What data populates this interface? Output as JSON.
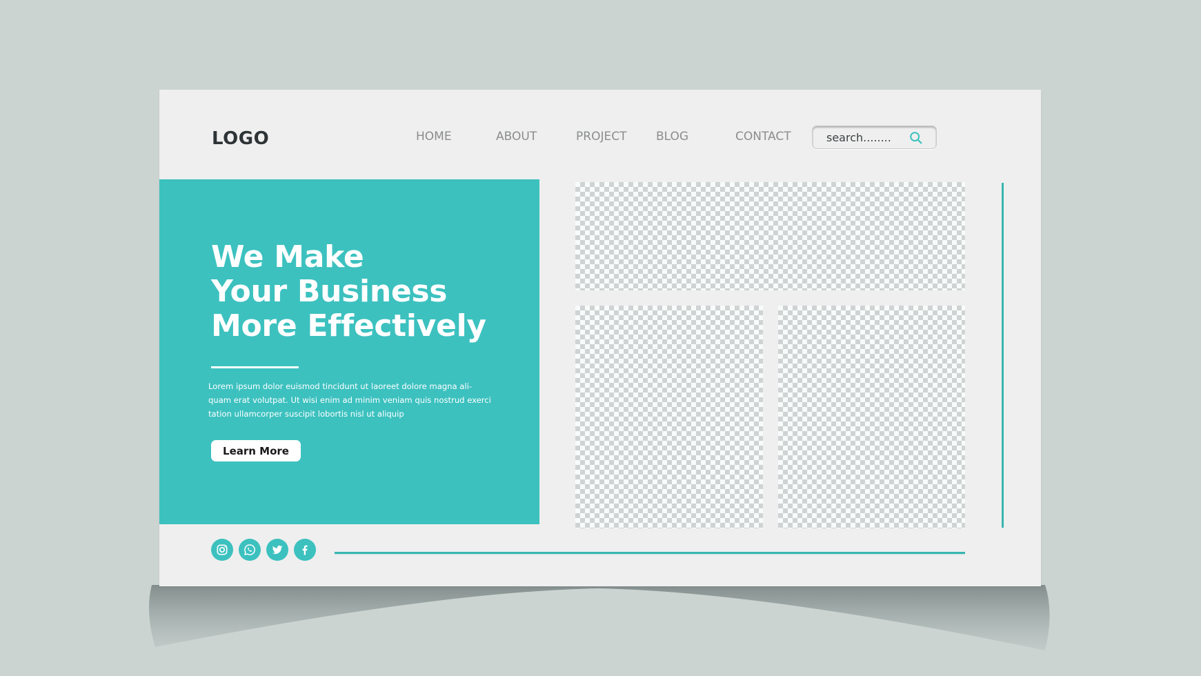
{
  "header": {
    "logo": "LOGO",
    "nav": [
      {
        "label": "HOME"
      },
      {
        "label": "ABOUT"
      },
      {
        "label": "PROJECT"
      },
      {
        "label": "BLOG"
      },
      {
        "label": "CONTACT"
      }
    ],
    "search": {
      "placeholder": "search........",
      "value": "",
      "icon": "search-icon"
    }
  },
  "hero": {
    "title_lines": [
      "We Make",
      "Your Business",
      "More Effectively"
    ],
    "body_lines": [
      "Lorem ipsum dolor euismod tincidunt ut laoreet dolore magna ali-",
      "quam erat volutpat. Ut wisi enim ad minim veniam quis nostrud exerci",
      "tation ullamcorper suscipit lobortis nisl ut aliquip"
    ],
    "cta_label": "Learn More"
  },
  "image_placeholders": [
    "top-wide",
    "bottom-left",
    "bottom-right"
  ],
  "social": [
    {
      "name": "instagram",
      "icon": "instagram-icon"
    },
    {
      "name": "whatsapp",
      "icon": "whatsapp-icon"
    },
    {
      "name": "twitter",
      "icon": "twitter-icon"
    },
    {
      "name": "facebook",
      "icon": "facebook-icon"
    }
  ],
  "colors": {
    "accent": "#3cc1bf",
    "accent_line": "#3ab5b0",
    "card": "#efefef",
    "background": "#cbd4d1",
    "logo_text": "#2e3336",
    "nav_text": "#8a8c8d"
  }
}
